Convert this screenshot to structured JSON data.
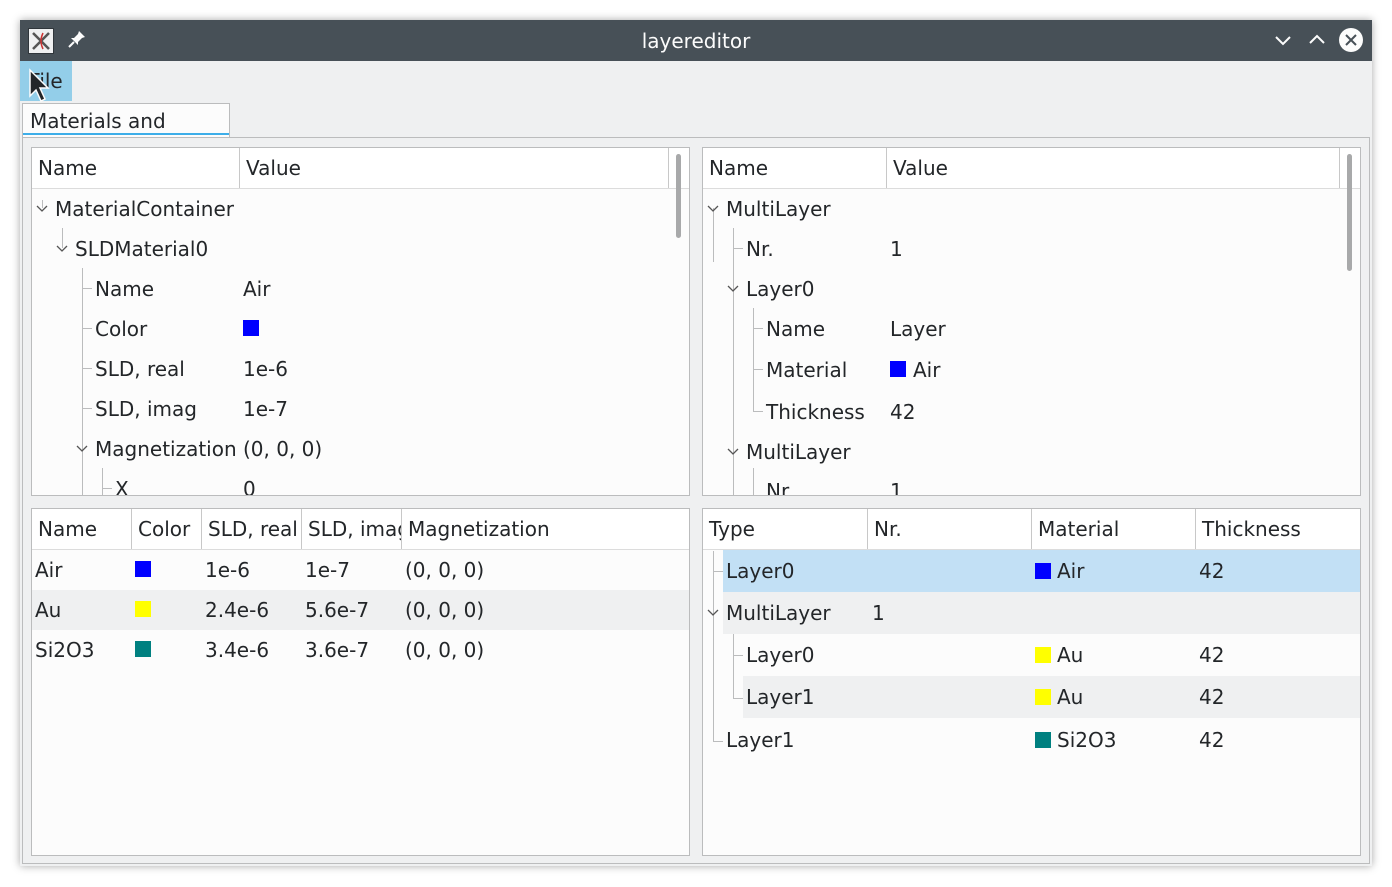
{
  "window": {
    "title": "layereditor"
  },
  "menu": {
    "file_label": "File"
  },
  "tabs": [
    {
      "label": "Materials and Layers"
    }
  ],
  "material_tree": {
    "headers": [
      "Name",
      "Value"
    ],
    "rows": [
      {
        "name": "MaterialContainer",
        "value": ""
      },
      {
        "name": "SLDMaterial0",
        "value": ""
      },
      {
        "name": "Name",
        "value": "Air"
      },
      {
        "name": "Color",
        "value": "",
        "color": "#0000ff"
      },
      {
        "name": "SLD, real",
        "value": "1e-6"
      },
      {
        "name": "SLD, imag",
        "value": "1e-7"
      },
      {
        "name": "Magnetization",
        "value": "(0, 0, 0)"
      },
      {
        "name": "X",
        "value": "0"
      }
    ]
  },
  "layer_tree": {
    "headers": [
      "Name",
      "Value"
    ],
    "rows": [
      {
        "name": "MultiLayer",
        "value": ""
      },
      {
        "name": "Nr.",
        "value": "1"
      },
      {
        "name": "Layer0",
        "value": ""
      },
      {
        "name": "Name",
        "value": "Layer"
      },
      {
        "name": "Material",
        "value": "Air",
        "color": "#0000ff"
      },
      {
        "name": "Thickness",
        "value": "42"
      },
      {
        "name": "MultiLayer",
        "value": ""
      },
      {
        "name": "Nr.",
        "value": "1"
      }
    ]
  },
  "material_table": {
    "headers": [
      "Name",
      "Color",
      "SLD, real",
      "SLD, imag",
      "Magnetization"
    ],
    "rows": [
      {
        "name": "Air",
        "color": "#0000ff",
        "sld_real": "1e-6",
        "sld_imag": "1e-7",
        "magnetization": "(0, 0, 0)"
      },
      {
        "name": "Au",
        "color": "#ffff00",
        "sld_real": "2.4e-6",
        "sld_imag": "5.6e-7",
        "magnetization": "(0, 0, 0)"
      },
      {
        "name": "Si2O3",
        "color": "#008080",
        "sld_real": "3.4e-6",
        "sld_imag": "3.6e-7",
        "magnetization": "(0, 0, 0)"
      }
    ]
  },
  "layer_table": {
    "headers": [
      "Type",
      "Nr.",
      "Material",
      "Thickness"
    ],
    "rows": [
      {
        "type": "Layer0",
        "nr": "",
        "material": "Air",
        "color": "#0000ff",
        "thickness": "42",
        "selected": true
      },
      {
        "type": "MultiLayer",
        "nr": "1",
        "material": "",
        "thickness": ""
      },
      {
        "type": "Layer0",
        "nr": "",
        "material": "Au",
        "color": "#ffff00",
        "thickness": "42"
      },
      {
        "type": "Layer1",
        "nr": "",
        "material": "Au",
        "color": "#ffff00",
        "thickness": "42"
      },
      {
        "type": "Layer1",
        "nr": "",
        "material": "Si2O3",
        "color": "#008080",
        "thickness": "42"
      }
    ]
  },
  "colors": {
    "titlebar": "#475057",
    "menu_highlight": "#93cee9",
    "selection": "#c2e0f5",
    "alt_row": "#eff0f1"
  }
}
